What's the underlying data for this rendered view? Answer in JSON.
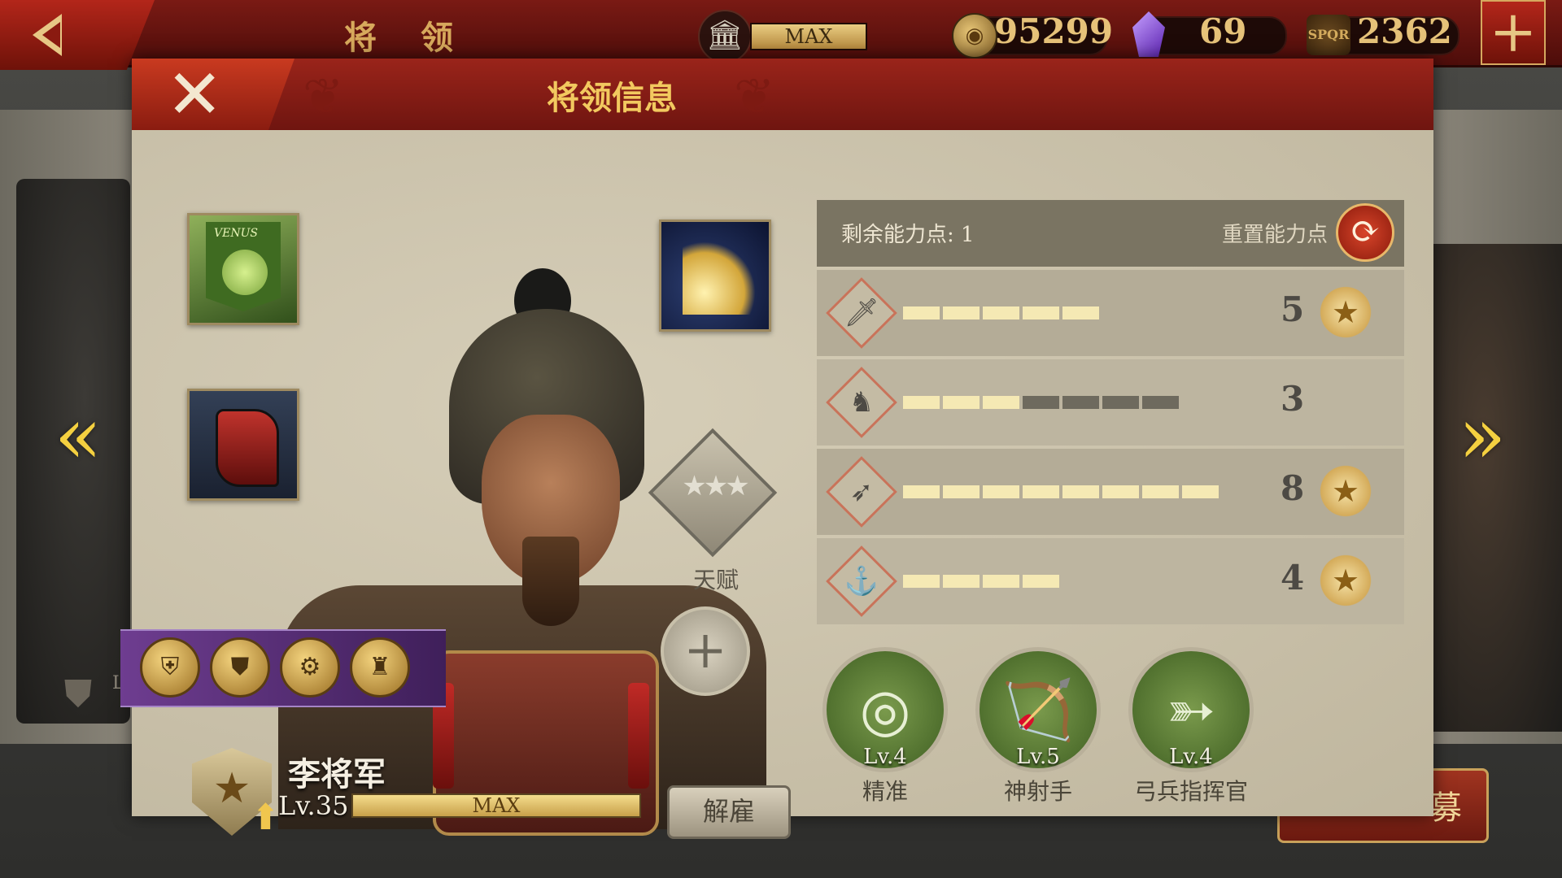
{
  "top_bar": {
    "title": "将 领",
    "max_label": "MAX",
    "coins": "95299",
    "gems": "69",
    "spqr_label": "SPQR",
    "honor": "2362"
  },
  "dialog": {
    "title": "将领信息"
  },
  "talent": {
    "label": "天赋"
  },
  "general": {
    "name": "李将军",
    "level": "Lv.35",
    "xp_label": "MAX",
    "dismiss_label": "解雇"
  },
  "ability": {
    "remaining_label": "剩余能力点: 1",
    "reset_label": "重置能力点",
    "stats": [
      {
        "icon": "sword-icon",
        "value": "5",
        "filled": 5,
        "total": 5,
        "medal": true
      },
      {
        "icon": "horse-icon",
        "value": "3",
        "filled": 3,
        "total": 7,
        "medal": false
      },
      {
        "icon": "bow-icon",
        "value": "8",
        "filled": 8,
        "total": 8,
        "medal": true
      },
      {
        "icon": "anchor-icon",
        "value": "4",
        "filled": 4,
        "total": 4,
        "medal": true
      }
    ]
  },
  "skills": [
    {
      "icon": "target-icon",
      "level": "Lv.4",
      "name": "精准"
    },
    {
      "icon": "archer-icon",
      "level": "Lv.5",
      "name": "神射手"
    },
    {
      "icon": "bow-commander-icon",
      "level": "Lv.4",
      "name": "弓兵指挥官"
    }
  ],
  "background": {
    "left_level": "Lv"
  },
  "colors": {
    "header_red": "#8a1c10",
    "gold": "#e6c279",
    "panel_bg": "#cfc7b1",
    "skill_green": "#5a7a36",
    "badge_purple": "#5a2e7a"
  }
}
